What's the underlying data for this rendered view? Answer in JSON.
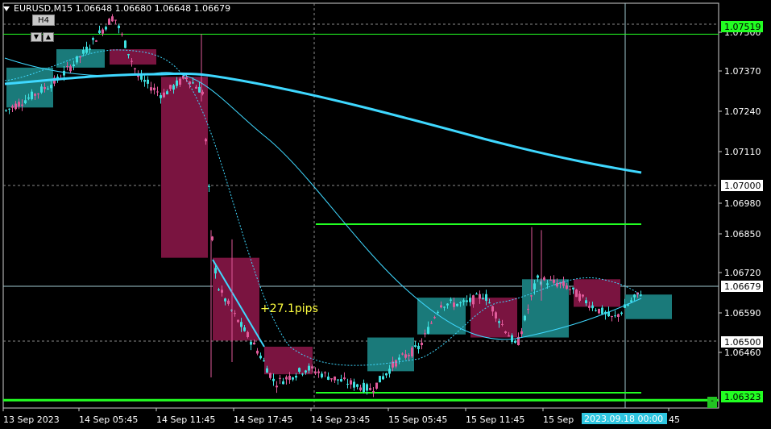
{
  "header": {
    "symbol_line": "EURUSD,M15  1.06648 1.06680 1.06648 1.06679",
    "timeframe_button": "H4"
  },
  "price_axis": {
    "labels": [
      "1.07500",
      "1.07370",
      "1.07240",
      "1.07110",
      "1.06980",
      "1.06850",
      "1.06720",
      "1.06590",
      "1.06460"
    ],
    "highlighted": [
      {
        "text": "1.07519",
        "bg": "#22ff22",
        "fg": "#000000"
      },
      {
        "text": "1.07000",
        "bg": "#ffffff",
        "fg": "#000000"
      },
      {
        "text": "1.06679",
        "bg": "#ffffff",
        "fg": "#000000"
      },
      {
        "text": "1.06500",
        "bg": "#ffffff",
        "fg": "#000000"
      },
      {
        "text": "1.06323",
        "bg": "#22ff22",
        "fg": "#000000"
      }
    ]
  },
  "time_axis": {
    "labels": [
      "13 Sep 2023",
      "14 Sep 05:45",
      "14 Sep 11:45",
      "14 Sep 17:45",
      "14 Sep 23:45",
      "15 Sep 05:45",
      "15 Sep 11:45",
      "15 Sep",
      "45"
    ],
    "crosshair_label": "2023.09.18 00:00"
  },
  "annotation": {
    "pips_text": "+27.1pips"
  },
  "colors": {
    "bull": "#3ee0e0",
    "bear": "#e05a9a",
    "bull_box": "#1a7a7a",
    "bear_box": "#7a1440",
    "ma": "#3fd8ff",
    "level": "#22ff22",
    "bg": "#000000"
  },
  "chart_data": {
    "type": "candlestick",
    "price_range": [
      1.063,
      1.0762
    ],
    "levels": {
      "resistance": 1.07519,
      "support": 1.06323,
      "current": 1.06679,
      "round_upper": 1.07,
      "round_lower": 1.065
    },
    "h4_boxes": [
      {
        "dir": "bull",
        "open": 1.0728,
        "close": 1.0741
      },
      {
        "dir": "bull",
        "open": 1.0741,
        "close": 1.0747
      },
      {
        "dir": "bear",
        "open": 1.0747,
        "close": 1.0742
      },
      {
        "dir": "bear",
        "open": 1.0738,
        "close": 1.0679
      },
      {
        "dir": "bear",
        "open": 1.0679,
        "close": 1.0652
      },
      {
        "dir": "bear",
        "open": 1.065,
        "close": 1.0641
      },
      {
        "dir": "bull",
        "open": 1.0642,
        "close": 1.0653
      },
      {
        "dir": "bull",
        "open": 1.0654,
        "close": 1.0666
      },
      {
        "dir": "bear",
        "open": 1.0666,
        "close": 1.0653
      },
      {
        "dir": "bull",
        "open": 1.0653,
        "close": 1.0672
      },
      {
        "dir": "bear",
        "open": 1.0672,
        "close": 1.0663
      },
      {
        "dir": "bull",
        "open": 1.0659,
        "close": 1.0667
      }
    ]
  }
}
